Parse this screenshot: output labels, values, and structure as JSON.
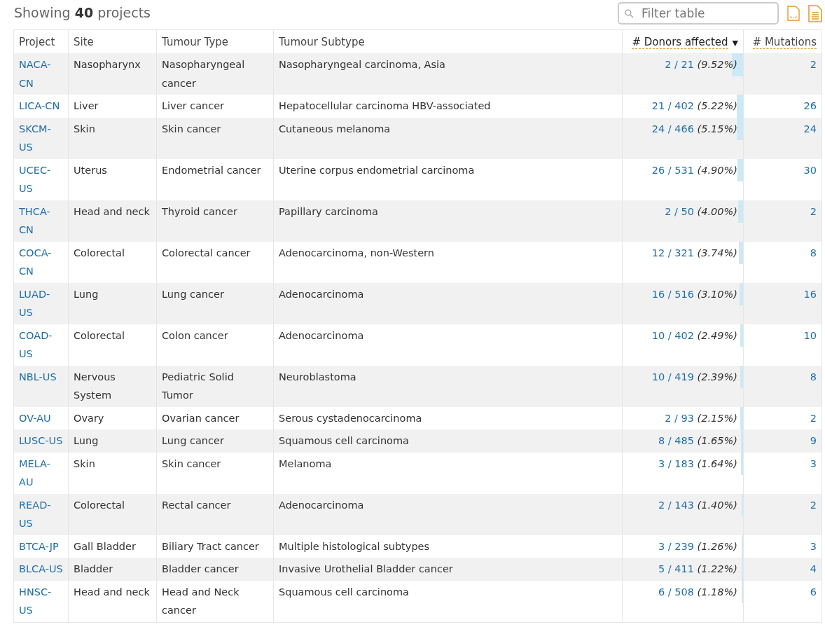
{
  "summary": {
    "prefix": "Showing",
    "count": "40",
    "suffix": "projects"
  },
  "filter": {
    "placeholder": "Filter table"
  },
  "columns": [
    {
      "label": "Project",
      "kind": "text",
      "dashed": false,
      "sorted": false
    },
    {
      "label": "Site",
      "kind": "text",
      "dashed": false,
      "sorted": false
    },
    {
      "label": "Tumour Type",
      "kind": "text",
      "dashed": false,
      "sorted": false
    },
    {
      "label": "Tumour Subtype",
      "kind": "text",
      "dashed": false,
      "sorted": false
    },
    {
      "label": "# Donors affected",
      "kind": "number",
      "dashed": true,
      "sorted": true,
      "sort_arrow": "▼"
    },
    {
      "label": "# Mutations",
      "kind": "number",
      "dashed": true,
      "sorted": false
    }
  ],
  "rows": [
    {
      "project": "NACA-CN",
      "site": "Nasopharynx",
      "type": "Nasopharyngeal cancer",
      "subtype": "Nasopharyngeal carcinoma, Asia",
      "donors": "2 / 21",
      "pct": "(9.52%)",
      "level": 0.0952,
      "mutations": "2"
    },
    {
      "project": "LICA-CN",
      "site": "Liver",
      "type": "Liver cancer",
      "subtype": "Hepatocellular carcinoma HBV-associated",
      "donors": "21 / 402",
      "pct": "(5.22%)",
      "level": 0.0522,
      "mutations": "26"
    },
    {
      "project": "SKCM-US",
      "site": "Skin",
      "type": "Skin cancer",
      "subtype": "Cutaneous melanoma",
      "donors": "24 / 466",
      "pct": "(5.15%)",
      "level": 0.0515,
      "mutations": "24"
    },
    {
      "project": "UCEC-US",
      "site": "Uterus",
      "type": "Endometrial cancer",
      "subtype": "Uterine corpus endometrial carcinoma",
      "donors": "26 / 531",
      "pct": "(4.90%)",
      "level": 0.049,
      "mutations": "30"
    },
    {
      "project": "THCA-CN",
      "site": "Head and neck",
      "type": "Thyroid cancer",
      "subtype": "Papillary carcinoma",
      "donors": "2 / 50",
      "pct": "(4.00%)",
      "level": 0.04,
      "mutations": "2"
    },
    {
      "project": "COCA-CN",
      "site": "Colorectal",
      "type": "Colorectal cancer",
      "subtype": "Adenocarcinoma, non-Western",
      "donors": "12 / 321",
      "pct": "(3.74%)",
      "level": 0.0374,
      "mutations": "8"
    },
    {
      "project": "LUAD-US",
      "site": "Lung",
      "type": "Lung cancer",
      "subtype": "Adenocarcinoma",
      "donors": "16 / 516",
      "pct": "(3.10%)",
      "level": 0.031,
      "mutations": "16"
    },
    {
      "project": "COAD-US",
      "site": "Colorectal",
      "type": "Colon cancer",
      "subtype": "Adenocarcinoma",
      "donors": "10 / 402",
      "pct": "(2.49%)",
      "level": 0.0249,
      "mutations": "10"
    },
    {
      "project": "NBL-US",
      "site": "Nervous System",
      "type": "Pediatric Solid Tumor",
      "subtype": "Neuroblastoma",
      "donors": "10 / 419",
      "pct": "(2.39%)",
      "level": 0.0239,
      "mutations": "8"
    },
    {
      "project": "OV-AU",
      "site": "Ovary",
      "type": "Ovarian cancer",
      "subtype": "Serous cystadenocarcinoma",
      "donors": "2 / 93",
      "pct": "(2.15%)",
      "level": 0.0215,
      "mutations": "2"
    },
    {
      "project": "LUSC-US",
      "site": "Lung",
      "type": "Lung cancer",
      "subtype": "Squamous cell carcinoma",
      "donors": "8 / 485",
      "pct": "(1.65%)",
      "level": 0.0165,
      "mutations": "9"
    },
    {
      "project": "MELA-AU",
      "site": "Skin",
      "type": "Skin cancer",
      "subtype": "Melanoma",
      "donors": "3 / 183",
      "pct": "(1.64%)",
      "level": 0.0164,
      "mutations": "3"
    },
    {
      "project": "READ-US",
      "site": "Colorectal",
      "type": "Rectal cancer",
      "subtype": "Adenocarcinoma",
      "donors": "2 / 143",
      "pct": "(1.40%)",
      "level": 0.014,
      "mutations": "2"
    },
    {
      "project": "BTCA-JP",
      "site": "Gall Bladder",
      "type": "Biliary Tract cancer",
      "subtype": "Multiple histological subtypes",
      "donors": "3 / 239",
      "pct": "(1.26%)",
      "level": 0.0126,
      "mutations": "3"
    },
    {
      "project": "BLCA-US",
      "site": "Bladder",
      "type": "Bladder cancer",
      "subtype": "Invasive Urothelial Bladder cancer",
      "donors": "5 / 411",
      "pct": "(1.22%)",
      "level": 0.0122,
      "mutations": "4"
    },
    {
      "project": "HNSC-US",
      "site": "Head and neck",
      "type": "Head and Neck cancer",
      "subtype": "Squamous cell carcinoma",
      "donors": "6 / 508",
      "pct": "(1.18%)",
      "level": 0.0118,
      "mutations": "6"
    }
  ]
}
